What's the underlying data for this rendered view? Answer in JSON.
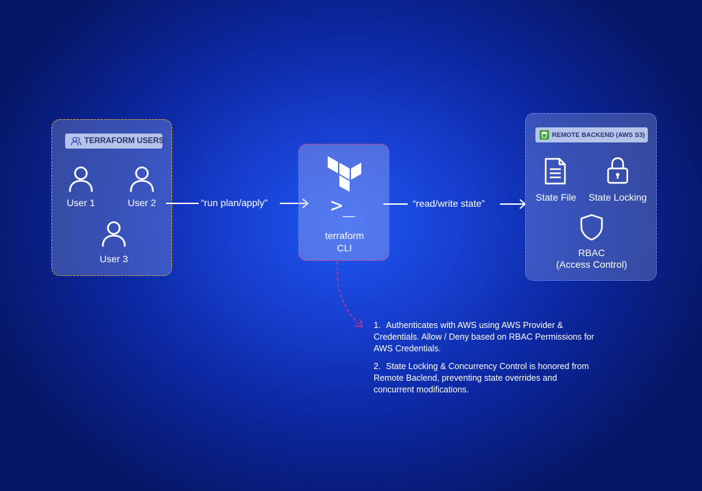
{
  "users_panel": {
    "title": "TERRAFORM USERS",
    "users": [
      "User 1",
      "User 2",
      "User 3"
    ]
  },
  "cli_panel": {
    "label_line1": "terraform",
    "label_line2": "CLI",
    "prompt": ">_"
  },
  "backend_panel": {
    "title": "REMOTE BACKEND (AWS S3)",
    "items": {
      "state_file": "State File",
      "state_locking": "State Locking",
      "rbac": "RBAC",
      "rbac_sub": "(Access Control)"
    }
  },
  "arrows": {
    "to_cli": "“run plan/apply”",
    "to_backend": "“read/write state”"
  },
  "notes": [
    {
      "num": "1.",
      "text": "Authenticates with AWS using AWS Provider & Credentials. Allow / Deny based on RBAC Permissions for AWS Credentials."
    },
    {
      "num": "2.",
      "text": "State Locking & Concurrency Control is honored from Remote Baclend, preventing state overrides and concurrent modifications."
    }
  ],
  "colors": {
    "users_border": "#d6a72e",
    "cli_border": "#d6367a",
    "backend_border": "#6f86f2",
    "pill_bg": "#b6c4ec",
    "pill_text": "#27336e",
    "s3_icon": "#3fa535"
  }
}
